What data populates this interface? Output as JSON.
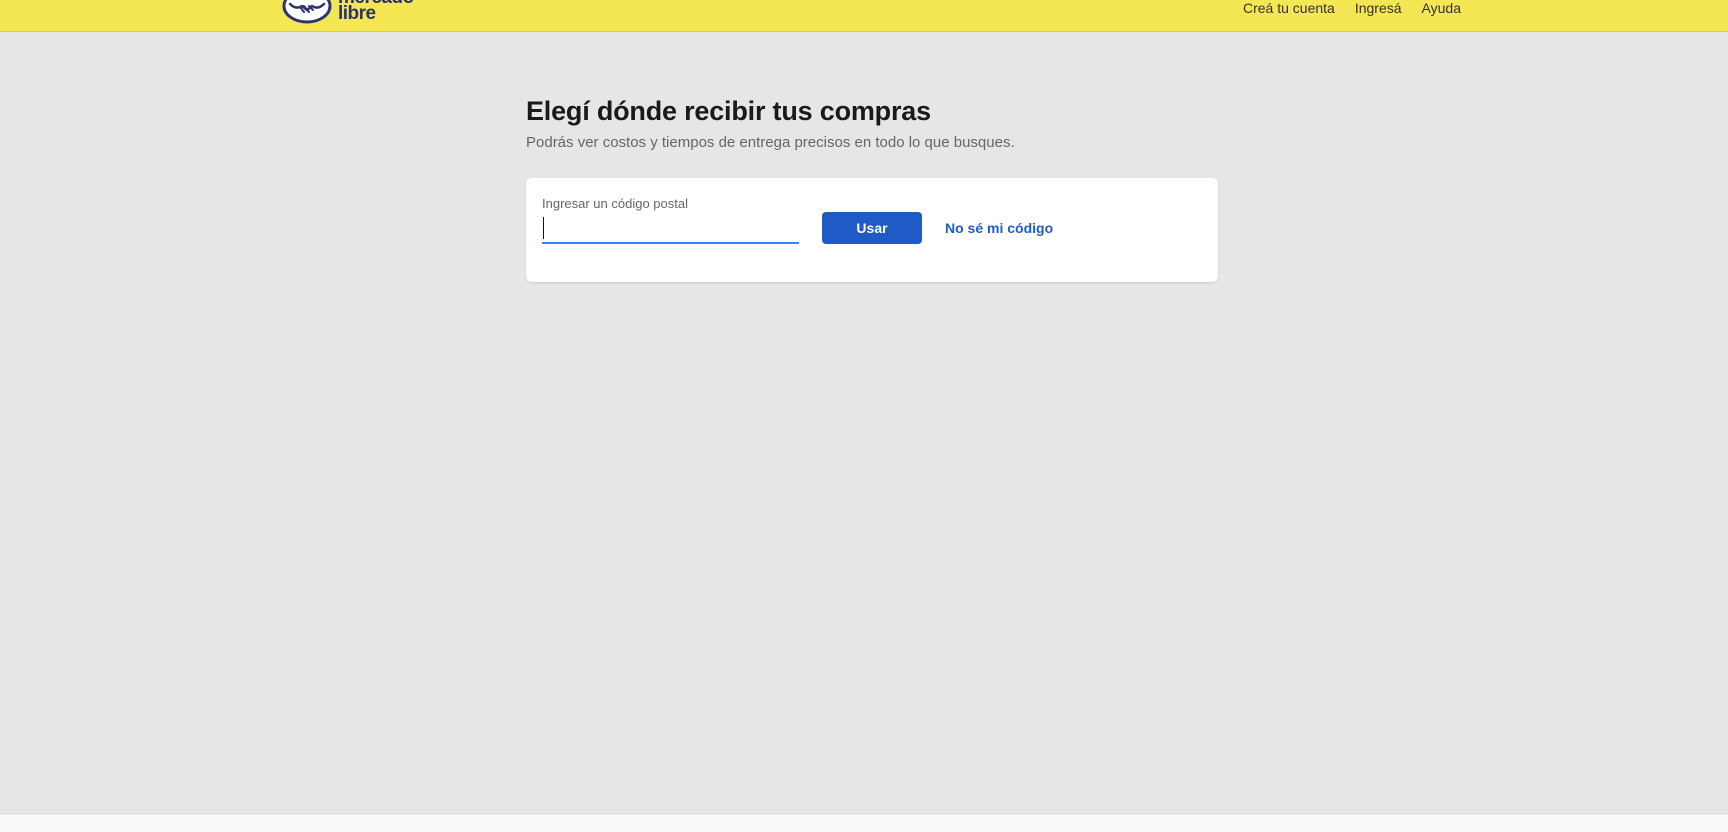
{
  "header": {
    "logo": {
      "line1": "mercado",
      "line2": "libre"
    },
    "nav": {
      "create_account": "Creá tu cuenta",
      "login": "Ingresá",
      "help": "Ayuda"
    },
    "colors": {
      "background": "#f5e653"
    }
  },
  "main": {
    "title": "Elegí dónde recibir tus compras",
    "subtitle": "Podrás ver costos y tiempos de entrega precisos en todo lo que busques.",
    "form": {
      "label": "Ingresar un código postal",
      "value": "",
      "submit_label": "Usar",
      "help_link": "No sé mi código"
    }
  },
  "colors": {
    "accent": "#1f5bc6",
    "page_background": "#e6e6e6"
  },
  "icons": {
    "logo": "handshake-logo-icon"
  }
}
